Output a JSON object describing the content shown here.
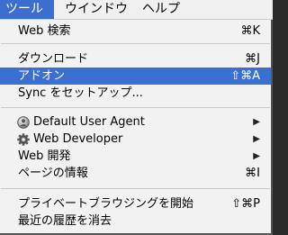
{
  "menubar": {
    "items": [
      {
        "label": "ツール"
      },
      {
        "label": "ウインドウ"
      },
      {
        "label": "ヘルプ"
      }
    ]
  },
  "menu": {
    "items": [
      {
        "label": "Web 検索",
        "shortcut": "⌘K"
      },
      {
        "label": "ダウンロード",
        "shortcut": "⌘J"
      },
      {
        "label": "アドオン",
        "shortcut": "⇧⌘A"
      },
      {
        "label": "Sync をセットアップ..."
      },
      {
        "label": "Default User Agent",
        "icon": "user-agent-icon"
      },
      {
        "label": "Web Developer",
        "icon": "gear-icon"
      },
      {
        "label": "Web 開発"
      },
      {
        "label": "ページの情報",
        "shortcut": "⌘I"
      },
      {
        "label": "プライベートブラウジングを開始",
        "shortcut": "⇧⌘P"
      },
      {
        "label": "最近の履歴を消去"
      }
    ]
  },
  "colors": {
    "highlight": "#3b6fd2",
    "menu_bg": "#f2f2f2"
  }
}
